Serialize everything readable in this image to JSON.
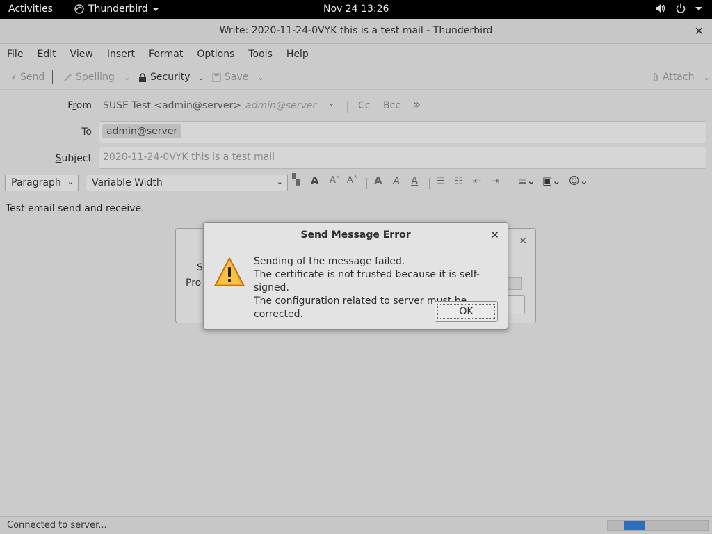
{
  "topbar": {
    "activities": "Activities",
    "app_name": "Thunderbird",
    "clock": "Nov 24  13:26"
  },
  "window": {
    "title": "Write: 2020-11-24-0VYK this is a test mail - Thunderbird"
  },
  "menubar": {
    "items": [
      {
        "label": "File",
        "mnemonic": "F",
        "rest": "ile"
      },
      {
        "label": "Edit",
        "mnemonic": "E",
        "rest": "dit"
      },
      {
        "label": "View",
        "mnemonic": "V",
        "rest": "iew"
      },
      {
        "label": "Insert",
        "mnemonic": "I",
        "rest": "nsert"
      },
      {
        "label": "Format",
        "mnemonic": "F",
        "rest": "ormat"
      },
      {
        "label": "Options",
        "mnemonic": "O",
        "rest": "ptions"
      },
      {
        "label": "Tools",
        "mnemonic": "T",
        "rest": "ools"
      },
      {
        "label": "Help",
        "mnemonic": "H",
        "rest": "elp"
      }
    ]
  },
  "toolbar": {
    "send": "Send",
    "spelling": "Spelling",
    "security": "Security",
    "save": "Save",
    "attach": "Attach"
  },
  "compose": {
    "from_label_pre": "F",
    "from_label_u": "r",
    "from_label_post": "om",
    "from_value": "SUSE Test <admin@server>",
    "from_identity": "admin@server",
    "cc": "Cc",
    "bcc": "Bcc",
    "to_label": "To",
    "to_recipient": "admin@server",
    "subject_label_u": "S",
    "subject_label_rest": "ubject",
    "subject_value": "2020-11-24-0VYK this is a test mail"
  },
  "format": {
    "paragraph": "Paragraph",
    "font": "Variable Width"
  },
  "editor": {
    "body": "Test email send and receive."
  },
  "status": {
    "text": "Connected to server...",
    "progress": 0.2
  },
  "bg_dialog": {
    "text1": "S",
    "text2": "Pro"
  },
  "error_dialog": {
    "title": "Send Message Error",
    "line1": "Sending of the message failed.",
    "line2": "The certificate is not trusted because it is self-signed.",
    "line3": "The configuration related to server must be corrected.",
    "ok": "OK"
  },
  "colors": {
    "accent": "#2e6fbd",
    "warning": "#f0a020"
  }
}
